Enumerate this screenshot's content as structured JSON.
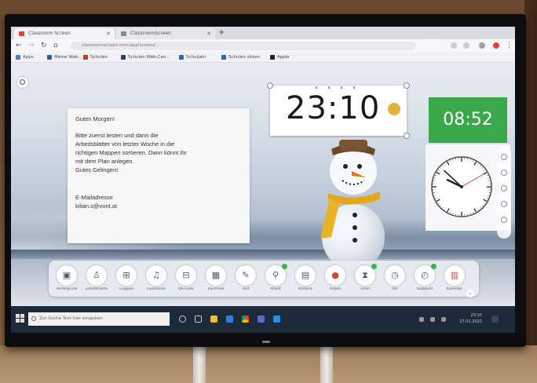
{
  "browser": {
    "tabs": [
      {
        "label": "Classroom Screen",
        "favicon_color": "#d9443c"
      },
      {
        "label": "ClassroomScreen",
        "favicon_color": "#7c8da6"
      }
    ],
    "url": "classroomscreen.com/app/screen/...",
    "bookmarks": [
      {
        "label": "Apps",
        "color": "#4d7ad0"
      },
      {
        "label": "Meine Web...",
        "color": "#2b5fb3"
      },
      {
        "label": "Schulen",
        "color": "#c0392b"
      },
      {
        "label": "Schulen Web-Cen...",
        "color": "#26456e"
      },
      {
        "label": "Schuljahr",
        "color": "#2e64c9"
      },
      {
        "label": "Schulen sitzen",
        "color": "#2e64c9"
      },
      {
        "label": "Apple",
        "color": "#222222"
      }
    ]
  },
  "note": {
    "greeting": "Guten Morgen!",
    "body": "Bitte zuerst testen und dann die\nArbeitsblätter von letzter Woche in die\nrichtigen Mappen sortieren. Dann könnt ihr\nmit dem Plan anlegen.\nGutes Gelingen!",
    "email_label": "E-Mailadresse",
    "email_value": "kilian.s@vorit.at"
  },
  "clock": {
    "time": "23:10"
  },
  "timer": {
    "time": "08:52"
  },
  "analog_clock": {
    "hour": 9,
    "minute": 52,
    "second": 10
  },
  "toolbar": {
    "tools": [
      {
        "name": "background",
        "glyph": "▣",
        "label": "Hintergrund",
        "badge": false
      },
      {
        "name": "random-name",
        "glyph": "♙",
        "label": "Zufallsname",
        "badge": false
      },
      {
        "name": "group-maker",
        "glyph": "⊞",
        "label": "Gruppen",
        "badge": false
      },
      {
        "name": "sound-level",
        "glyph": "♫",
        "label": "Lautstärke",
        "badge": false
      },
      {
        "name": "qr-code",
        "glyph": "⊟",
        "label": "QR-Code",
        "badge": false
      },
      {
        "name": "drawing",
        "glyph": "▦",
        "label": "Zeichnen",
        "badge": false
      },
      {
        "name": "text",
        "glyph": "✎",
        "label": "Text",
        "badge": false
      },
      {
        "name": "work-symbols",
        "glyph": "⚲",
        "label": "Arbeit",
        "badge": true
      },
      {
        "name": "webcam",
        "glyph": "▤",
        "label": "Kamera",
        "badge": false
      },
      {
        "name": "traffic-light",
        "glyph": "●",
        "label": "Ampel",
        "badge": false
      },
      {
        "name": "timer",
        "glyph": "⧗",
        "label": "Timer",
        "badge": true
      },
      {
        "name": "clock",
        "glyph": "◷",
        "label": "Uhr",
        "badge": false
      },
      {
        "name": "stopwatch",
        "glyph": "◴",
        "label": "Stoppuhr",
        "badge": true
      },
      {
        "name": "calendar",
        "glyph": "▥",
        "label": "Kalender",
        "badge": false
      }
    ]
  },
  "taskbar": {
    "search_placeholder": "Zur Suche Text hier eingeben",
    "tray": "23:10\n17.01.2022"
  },
  "colors": {
    "timer_green": "#3aa84a",
    "badge_yellow": "#e2b23c",
    "scarf": "#e3a81a"
  }
}
